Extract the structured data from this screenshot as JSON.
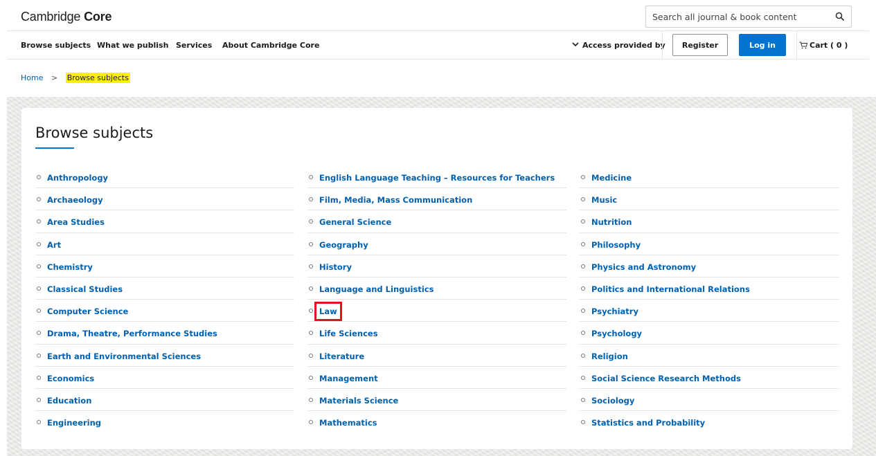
{
  "header": {
    "logo_light": "Cambridge",
    "logo_bold": "Core",
    "search_placeholder": "Search all journal & book content"
  },
  "nav": {
    "items": [
      "Browse subjects",
      "What we publish",
      "Services",
      "About Cambridge Core"
    ],
    "access_label": "Access provided by",
    "register_label": "Register",
    "login_label": "Log in",
    "cart_label": "Cart ( 0 )"
  },
  "breadcrumb": {
    "home": "Home",
    "separator": ">",
    "current": "Browse subjects"
  },
  "main": {
    "title": "Browse subjects",
    "columns": [
      [
        "Anthropology",
        "Archaeology",
        "Area Studies",
        "Art",
        "Chemistry",
        "Classical Studies",
        "Computer Science",
        "Drama, Theatre, Performance Studies",
        "Earth and Environmental Sciences",
        "Economics",
        "Education",
        "Engineering"
      ],
      [
        "English Language Teaching – Resources for Teachers",
        "Film, Media, Mass Communication",
        "General Science",
        "Geography",
        "History",
        "Language and Linguistics",
        "Law",
        "Life Sciences",
        "Literature",
        "Management",
        "Materials Science",
        "Mathematics"
      ],
      [
        "Medicine",
        "Music",
        "Nutrition",
        "Philosophy",
        "Physics and Astronomy",
        "Politics and International Relations",
        "Psychiatry",
        "Psychology",
        "Religion",
        "Social Science Research Methods",
        "Sociology",
        "Statistics and Probability"
      ]
    ],
    "highlighted_item": "Law"
  },
  "colors": {
    "link": "#0060b0",
    "accent": "#0072cf",
    "highlight_box": "#e0141e",
    "breadcrumb_highlight": "#fff200"
  }
}
